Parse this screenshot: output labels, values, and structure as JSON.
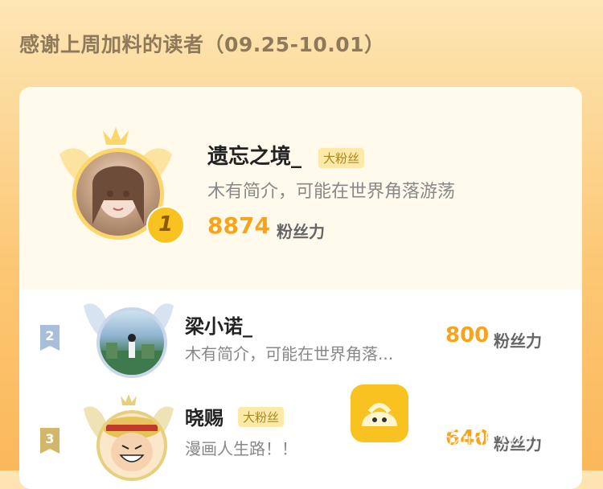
{
  "header": {
    "title": "感谢上周加料的读者（09.25-10.01）"
  },
  "readers": [
    {
      "rank": "1",
      "name": "遗忘之境_",
      "badge": "大粉丝",
      "bio": "木有简介，可能在世界角落游荡",
      "score": "8874",
      "unit": "粉丝力"
    },
    {
      "rank": "2",
      "name": "梁小诺_",
      "badge": "",
      "bio": "木有简介，可能在世界角落...",
      "score": "800",
      "unit": "粉丝力"
    },
    {
      "rank": "3",
      "name": "晓赐",
      "badge": "大粉丝",
      "bio": "漫画人生路！！",
      "score": "640",
      "unit": "粉丝力"
    }
  ],
  "watermark": {
    "text": "包子漫畫",
    "url": "baozimh.com"
  },
  "colors": {
    "gold": "#f6a31e",
    "silver": "#a9bfd9",
    "bronze": "#d2b66a",
    "badge_bg": "#fde9a8"
  }
}
